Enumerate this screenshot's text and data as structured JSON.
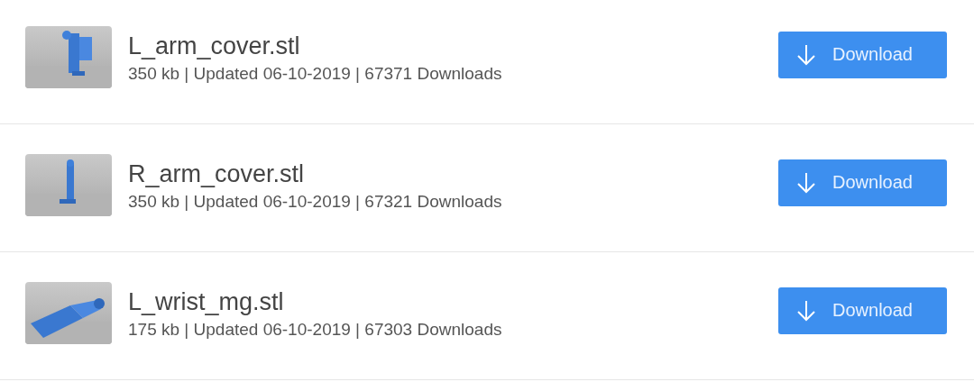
{
  "files": [
    {
      "name": "L_arm_cover.stl",
      "meta": "350 kb | Updated 06-10-2019 | 67371 Downloads",
      "button": "Download"
    },
    {
      "name": "R_arm_cover.stl",
      "meta": "350 kb | Updated 06-10-2019 | 67321 Downloads",
      "button": "Download"
    },
    {
      "name": "L_wrist_mg.stl",
      "meta": "175 kb | Updated 06-10-2019 | 67303 Downloads",
      "button": "Download"
    }
  ]
}
